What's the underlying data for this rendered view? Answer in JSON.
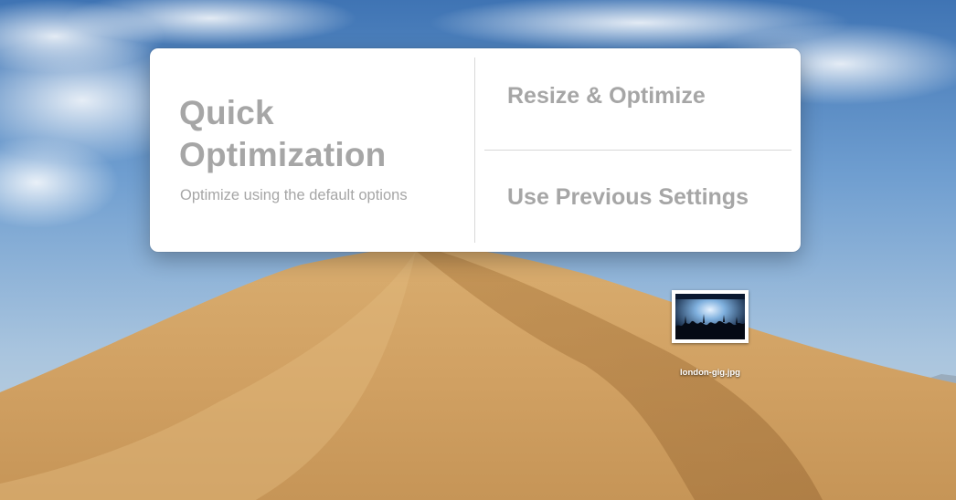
{
  "options": {
    "quick": {
      "title": "Quick Optimization",
      "subtitle": "Optimize using the default options"
    },
    "resize": {
      "label": "Resize & Optimize"
    },
    "previous": {
      "label": "Use Previous Settings"
    }
  },
  "desktop": {
    "file": {
      "name": "london-gig.jpg",
      "icon": "image-file-icon"
    }
  },
  "colors": {
    "panel_background": "#ffffff",
    "option_text": "#a6a6a6",
    "divider": "#d8d8d8"
  }
}
